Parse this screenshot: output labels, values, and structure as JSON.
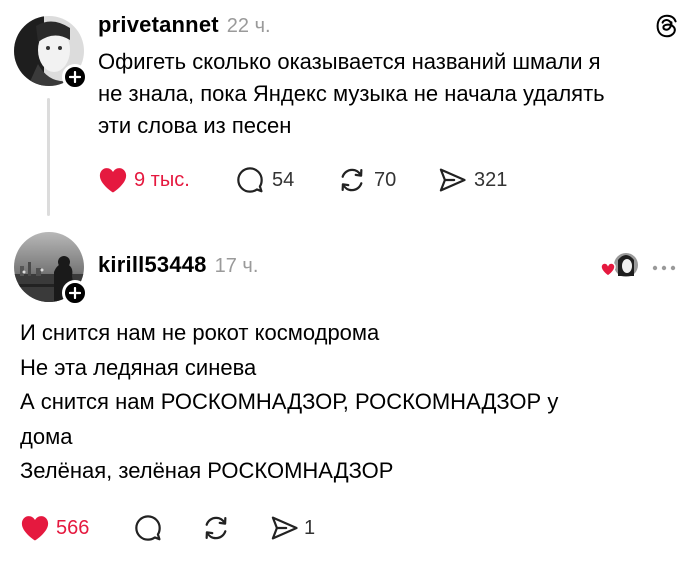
{
  "post": {
    "username": "privetannet",
    "time": "22 ч.",
    "lines": [
      "Офигеть сколько оказывается названий шмали я",
      "не знала, пока Яндекс музыка не начала удалять",
      "эти слова из песен"
    ],
    "likes": "9 тыс.",
    "replies": "54",
    "reposts": "70",
    "shares": "321"
  },
  "reply": {
    "username": "kirill53448",
    "time": "17 ч.",
    "lines": [
      "И снится нам не рокот космодрома",
      "Не эта ледяная синева",
      "А снится нам РОСКОМНАДЗОР, РОСКОМНАДЗОР у",
      "дома",
      "Зелёная, зелёная РОСКОМНАДЗОР"
    ],
    "likes": "566",
    "shares": "1"
  },
  "colors": {
    "like_red": "#e5193f",
    "muted": "#9a9a9a",
    "thread_line": "#dcdcdc"
  },
  "icons": [
    "threads-logo-icon",
    "heart-icon",
    "comment-icon",
    "repost-icon",
    "share-icon",
    "more-icon",
    "plus-icon"
  ]
}
